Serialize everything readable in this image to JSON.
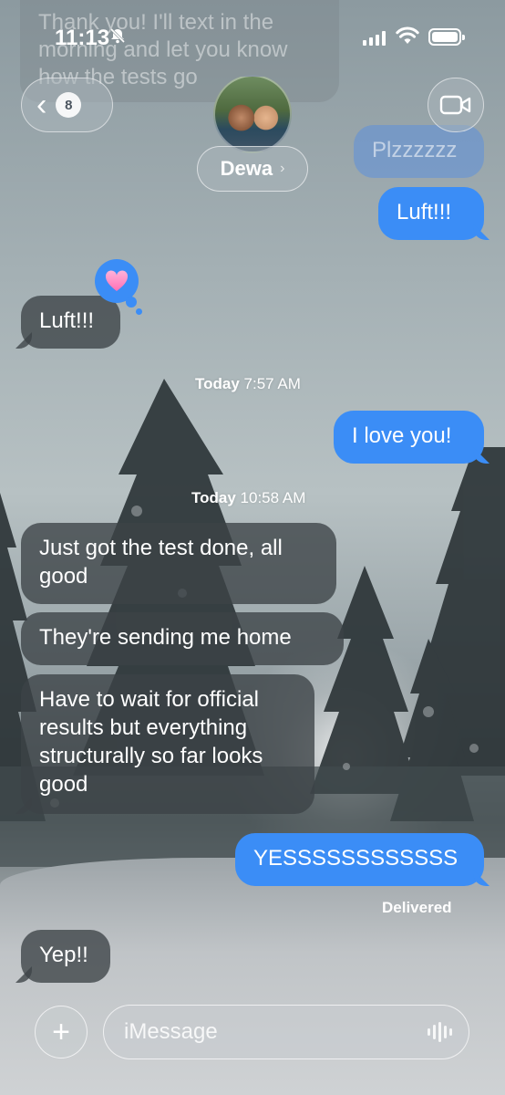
{
  "status_bar": {
    "time": "11:13"
  },
  "header": {
    "ghost_message": "Thank you! I'll text in the morning and let you know how the tests go",
    "back_count": "8",
    "contact_name": "Dewa"
  },
  "messages": [
    {
      "from": "me",
      "text": "Plzzzzzz",
      "faded": true
    },
    {
      "from": "me",
      "text": "Luft!!!"
    },
    {
      "from": "them",
      "text": "Luft!!!",
      "reaction": "heart"
    },
    {
      "type": "timestamp",
      "day": "Today",
      "time": "7:57 AM"
    },
    {
      "from": "me",
      "text": "I love you!"
    },
    {
      "type": "timestamp",
      "day": "Today",
      "time": "10:58 AM"
    },
    {
      "from": "them",
      "text": "Just got the test done, all good"
    },
    {
      "from": "them",
      "text": "They're sending me home"
    },
    {
      "from": "them",
      "text": "Have to wait for official results but everything structurally so far looks good"
    },
    {
      "from": "me",
      "text": "YESSSSSSSSSSSS"
    },
    {
      "type": "receipt",
      "text": "Delivered"
    },
    {
      "from": "them",
      "text": "Yep!!"
    }
  ],
  "composer": {
    "placeholder": "iMessage"
  },
  "colors": {
    "sent_bubble": "#3b8df6",
    "received_bubble": "#3c4246"
  }
}
